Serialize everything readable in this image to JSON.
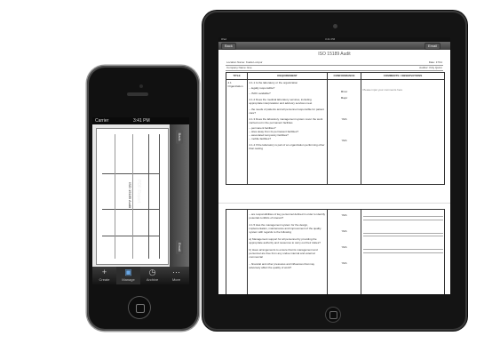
{
  "ipad": {
    "status": {
      "carrier": "iPad",
      "time": "3:41 PM"
    },
    "nav": {
      "back_label": "Back",
      "email_label": "Email"
    },
    "doc_title": "ISO 15189 Audit",
    "meta": {
      "left1": "Location Name: Kuala Lumpur",
      "right1": "Date: 17/11",
      "left2": "Company Name: Exe",
      "right2": "Auditor: Kitty Quinn"
    },
    "table": {
      "headers": [
        "TITLE",
        "REQUIREMENT",
        "CONFORMANCE",
        "COMMENTS / OBSERVATIONS"
      ],
      "title_cell": "4.1 Organization",
      "requirements": [
        "4.1.1 Is the laboratory or the organization",
        "– legally responsible?",
        "– ISOC available?",
        "4.1.2 Does the medical laboratory services, including appropriate interpretation and advisory services meet",
        "– the needs of patients and all personnel responsible for patient care?",
        "4.1.3 Does the laboratory management system cover the work carried out in the permanent facilities",
        "– permanent facilities?",
        "– sites away from its permanent facilities?",
        "– associated temporary facilities?",
        "– mobile facilities?",
        "4.1.4 If the laboratory is part of an organization performing other than testing"
      ],
      "conformance": [
        "Minor",
        "Major",
        "YES",
        "YES"
      ],
      "comment": "Please input your comments here",
      "page2_requirements": [
        "– are responsibilities of key personnel defined in order to identify potential conflicts of interest?",
        "4.1.5 Has the management system for the design, implementation, maintenance and improvement of the quality system with regards to the following",
        "a) Management support for all personnel by providing the appropriate authority and resources to carry out their duties?",
        "b) Have arrangements to ensure that its management and personnel are free from any undue internal and external commercial",
        "– financial and other pressures and influences that may adversely affect the quality of work?"
      ],
      "page2_conformance": [
        "YES",
        "YES",
        "YES",
        "YES"
      ]
    }
  },
  "iphone": {
    "status": {
      "carrier": "Carrier",
      "time": "3:41 PM"
    },
    "nav": {
      "back_label": "Back",
      "title": "PDF Report",
      "email_label": "Email"
    },
    "doc_title": "ISO 15189 Audit",
    "tabs": [
      {
        "label": "Create",
        "icon": "plus-icon"
      },
      {
        "label": "Manage",
        "icon": "document-icon"
      },
      {
        "label": "Archive",
        "icon": "clock-icon"
      },
      {
        "label": "More",
        "icon": "more-icon"
      }
    ]
  }
}
